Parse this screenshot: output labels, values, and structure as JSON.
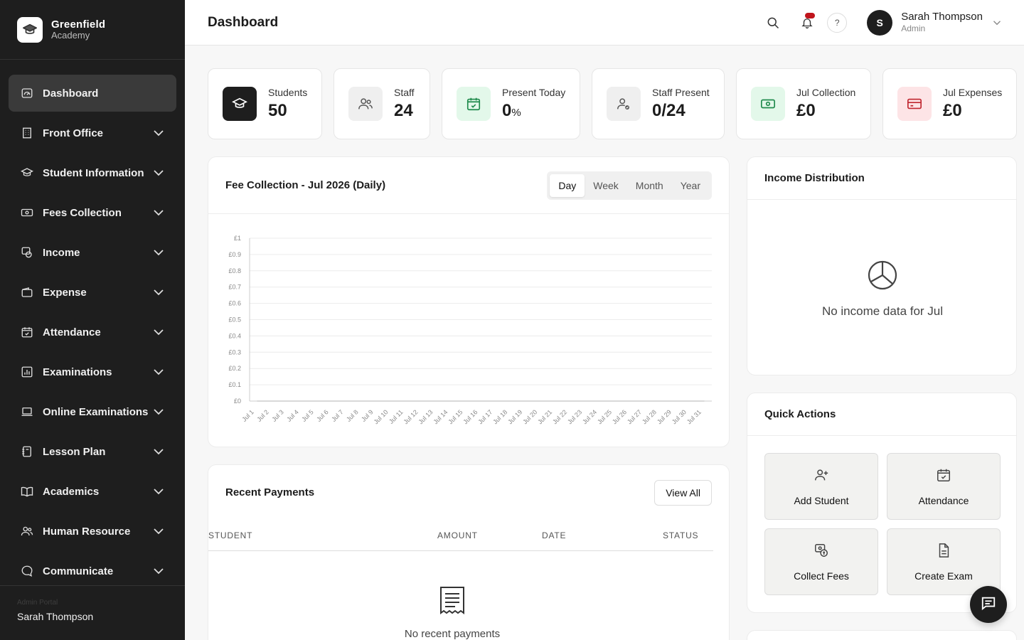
{
  "brand": {
    "name": "Greenfield",
    "sub": "Academy"
  },
  "sidebar": {
    "items": [
      {
        "label": "Dashboard",
        "icon": "dashboard-icon"
      },
      {
        "label": "Front Office",
        "icon": "building-icon"
      },
      {
        "label": "Student Information",
        "icon": "graduation-cap-icon"
      },
      {
        "label": "Fees Collection",
        "icon": "banknote-icon"
      },
      {
        "label": "Income",
        "icon": "coins-icon"
      },
      {
        "label": "Expense",
        "icon": "wallet-icon"
      },
      {
        "label": "Attendance",
        "icon": "calendar-check-icon"
      },
      {
        "label": "Examinations",
        "icon": "chart-icon"
      },
      {
        "label": "Online Examinations",
        "icon": "laptop-icon"
      },
      {
        "label": "Lesson Plan",
        "icon": "notebook-icon"
      },
      {
        "label": "Academics",
        "icon": "book-icon"
      },
      {
        "label": "Human Resource",
        "icon": "users-icon"
      },
      {
        "label": "Communicate",
        "icon": "message-icon"
      }
    ],
    "footer_label": "Admin Portal",
    "footer_user": "Sarah Thompson"
  },
  "header": {
    "title": "Dashboard",
    "help": "?",
    "user_initial": "S",
    "user_name": "Sarah Thompson",
    "user_role": "Admin"
  },
  "stats": {
    "students": {
      "label": "Students",
      "value": "50"
    },
    "staff": {
      "label": "Staff",
      "value": "24"
    },
    "present_today": {
      "label": "Present Today",
      "value": "0",
      "unit": "%"
    },
    "staff_present": {
      "label": "Staff Present",
      "value": "0/24"
    },
    "collection": {
      "label": "Jul Collection",
      "value": "£0"
    },
    "expenses": {
      "label": "Jul Expenses",
      "value": "£0"
    }
  },
  "fee_panel": {
    "title": "Fee Collection - Jul 2026 (Daily)",
    "tabs": [
      "Day",
      "Week",
      "Month",
      "Year"
    ]
  },
  "chart_data": {
    "type": "line",
    "title": "Fee Collection - Jul 2026 (Daily)",
    "categories": [
      "Jul 1",
      "Jul 2",
      "Jul 3",
      "Jul 4",
      "Jul 5",
      "Jul 6",
      "Jul 7",
      "Jul 8",
      "Jul 9",
      "Jul 10",
      "Jul 11",
      "Jul 12",
      "Jul 13",
      "Jul 14",
      "Jul 15",
      "Jul 16",
      "Jul 17",
      "Jul 18",
      "Jul 19",
      "Jul 20",
      "Jul 21",
      "Jul 22",
      "Jul 23",
      "Jul 24",
      "Jul 25",
      "Jul 26",
      "Jul 27",
      "Jul 28",
      "Jul 29",
      "Jul 30",
      "Jul 31"
    ],
    "values": [
      0,
      0,
      0,
      0,
      0,
      0,
      0,
      0,
      0,
      0,
      0,
      0,
      0,
      0,
      0,
      0,
      0,
      0,
      0,
      0,
      0,
      0,
      0,
      0,
      0,
      0,
      0,
      0,
      0,
      0,
      0
    ],
    "y_ticks": [
      "£0",
      "£0.1",
      "£0.2",
      "£0.3",
      "£0.4",
      "£0.5",
      "£0.6",
      "£0.7",
      "£0.8",
      "£0.9",
      "£1"
    ],
    "ylim": [
      0,
      1
    ],
    "grid": true,
    "line_color": "#1e1e1e"
  },
  "payments": {
    "title": "Recent Payments",
    "view_all": "View All",
    "columns": [
      "STUDENT",
      "AMOUNT",
      "DATE",
      "STATUS"
    ],
    "empty": "No recent payments"
  },
  "income": {
    "title": "Income Distribution",
    "empty": "No income data for Jul"
  },
  "quick_actions": {
    "title": "Quick Actions",
    "items": [
      {
        "label": "Add Student",
        "icon": "user-plus-icon"
      },
      {
        "label": "Attendance",
        "icon": "calendar-check-icon"
      },
      {
        "label": "Collect Fees",
        "icon": "money-icon"
      },
      {
        "label": "Create Exam",
        "icon": "file-icon"
      }
    ]
  },
  "colors": {
    "sidebar_bg": "#1e1e1e",
    "accent_green": "#e3f8ea",
    "accent_red": "#fde4e6",
    "neutral_icon_bg": "#efefef"
  }
}
